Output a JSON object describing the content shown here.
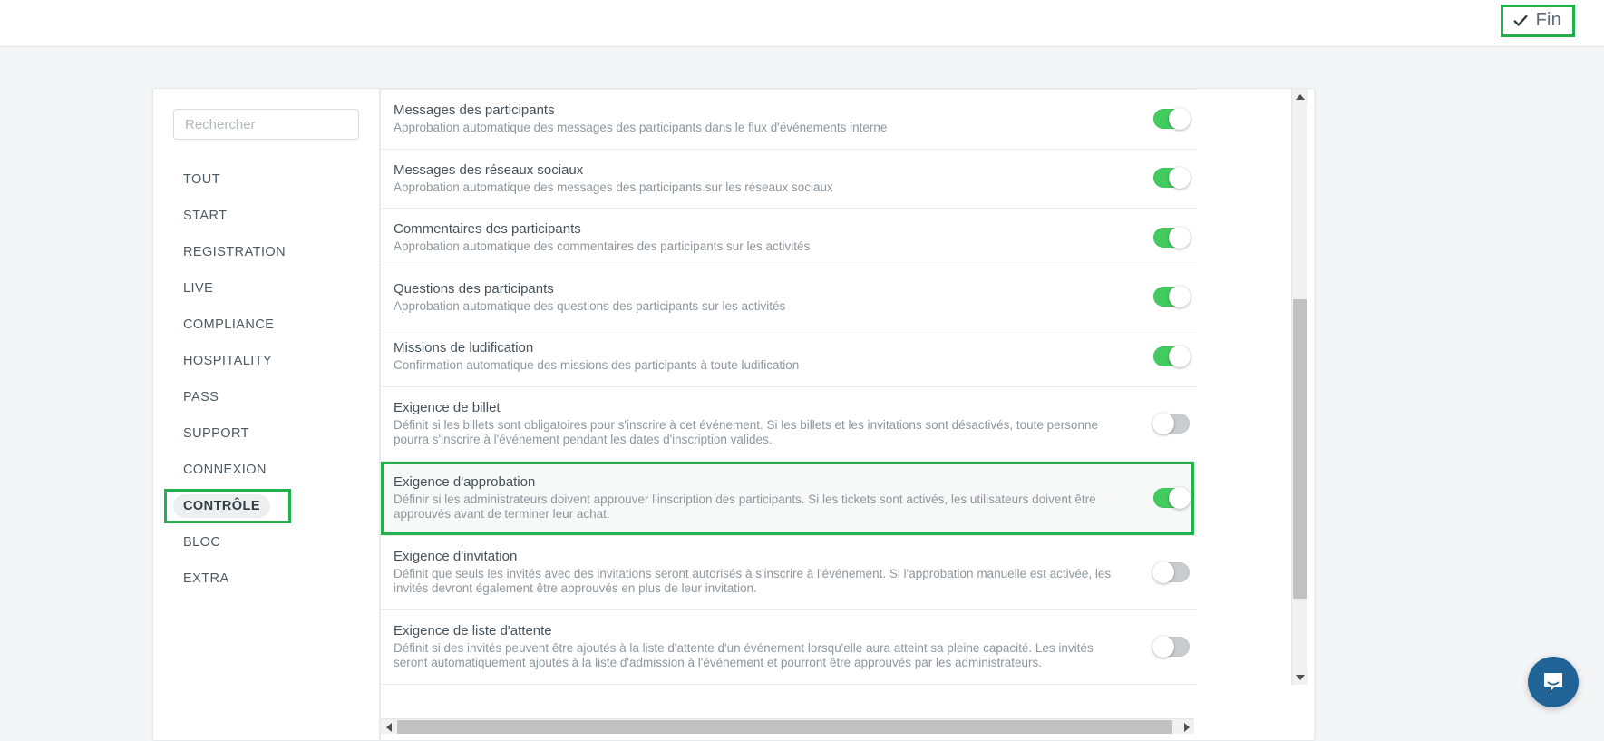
{
  "topbar": {
    "finish_button_label": "Fin",
    "check_icon": "check-icon",
    "highlight_color": "#22b14c"
  },
  "sidebar": {
    "search": {
      "placeholder": "Rechercher",
      "value": ""
    },
    "items": [
      {
        "label": "TOUT"
      },
      {
        "label": "START"
      },
      {
        "label": "REGISTRATION"
      },
      {
        "label": "LIVE"
      },
      {
        "label": "COMPLIANCE"
      },
      {
        "label": "HOSPITALITY"
      },
      {
        "label": "PASS"
      },
      {
        "label": "SUPPORT"
      },
      {
        "label": "CONNEXION"
      },
      {
        "label": "CONTRÔLE"
      },
      {
        "label": "BLOC"
      },
      {
        "label": "EXTRA"
      }
    ],
    "active_index": 9,
    "highlighted_index": 9
  },
  "settings": {
    "rows": [
      {
        "title": "Messages des participants",
        "description": "Approbation automatique des messages des participants dans le flux d'événements interne",
        "toggle": "on",
        "highlighted": false
      },
      {
        "title": "Messages des réseaux sociaux",
        "description": "Approbation automatique des messages des participants sur les réseaux sociaux",
        "toggle": "on",
        "highlighted": false
      },
      {
        "title": "Commentaires des participants",
        "description": "Approbation automatique des commentaires des participants sur les activités",
        "toggle": "on",
        "highlighted": false
      },
      {
        "title": "Questions des participants",
        "description": "Approbation automatique des questions des participants sur les activités",
        "toggle": "on",
        "highlighted": false
      },
      {
        "title": "Missions de ludification",
        "description": "Confirmation automatique des missions des participants à toute ludification",
        "toggle": "on",
        "highlighted": false
      },
      {
        "title": "Exigence de billet",
        "description": "Définit si les billets sont obligatoires pour s'inscrire à cet événement. Si les billets et les invitations sont désactivés, toute personne pourra s'inscrire à l'événement pendant les dates d'inscription valides.",
        "toggle": "off",
        "highlighted": false
      },
      {
        "title": "Exigence d'approbation",
        "description": "Définir si les administrateurs doivent approuver l'inscription des participants. Si les tickets sont activés, les utilisateurs doivent être approuvés avant de terminer leur achat.",
        "toggle": "on",
        "highlighted": true
      },
      {
        "title": "Exigence d'invitation",
        "description": "Définit que seuls les invités avec des invitations seront autorisés à s'inscrire à l'événement. Si l'approbation manuelle est activée, les invités devront également être approuvés en plus de leur invitation.",
        "toggle": "off",
        "highlighted": false
      },
      {
        "title": "Exigence de liste d'attente",
        "description": "Définit si des invités peuvent être ajoutés à la liste d'attente d'un événement lorsqu'elle aura atteint sa pleine capacité. Les invités seront automatiquement ajoutés à la liste d'admission à l'événement et pourront être approuvés par les administrateurs.",
        "toggle": "off",
        "highlighted": false
      }
    ]
  },
  "scrollbars": {
    "vertical": {
      "up_icon": "triangle-up-icon",
      "down_icon": "triangle-down-icon"
    },
    "horizontal": {
      "left_icon": "triangle-left-icon",
      "right_icon": "triangle-right-icon"
    }
  },
  "chat": {
    "launcher_icon": "chat-bubble-icon",
    "color": "#1f6397"
  }
}
